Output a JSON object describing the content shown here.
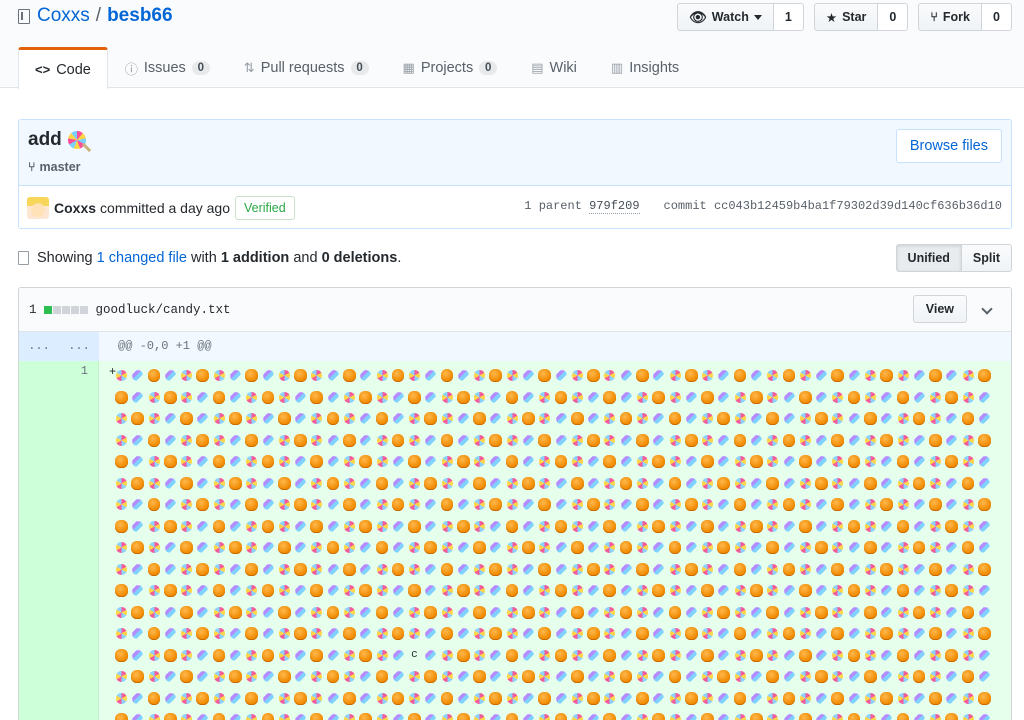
{
  "repo": {
    "owner": "Coxxs",
    "separator": "/",
    "name": "besb66"
  },
  "actions": {
    "watch": {
      "label": "Watch",
      "count": "1"
    },
    "star": {
      "label": "Star",
      "count": "0"
    },
    "fork": {
      "label": "Fork",
      "count": "0"
    }
  },
  "nav": {
    "tabs": [
      {
        "label": "Code",
        "icon": "<>"
      },
      {
        "label": "Issues",
        "count": "0"
      },
      {
        "label": "Pull requests",
        "count": "0"
      },
      {
        "label": "Projects",
        "count": "0"
      },
      {
        "label": "Wiki"
      },
      {
        "label": "Insights"
      }
    ]
  },
  "commit": {
    "title": "add",
    "branch": "master",
    "browse_label": "Browse files",
    "author": "Coxxs",
    "committed_text": "committed a day ago",
    "verified": "Verified",
    "parent_label": "1 parent",
    "parent_sha": "979f209",
    "commit_label": "commit",
    "commit_sha": "cc043b12459b4ba1f79302d39d140cf636b36d10"
  },
  "toc": {
    "showing": "Showing",
    "changed_link": "1 changed file",
    "with": "with",
    "additions": "1 addition",
    "and": "and",
    "deletions": "0 deletions",
    "period": ".",
    "unified": "Unified",
    "split": "Split"
  },
  "file": {
    "stat_count": "1",
    "path": "goodluck/candy.txt",
    "view_label": "View",
    "hunk_old": "...",
    "hunk_new": "...",
    "hunk_header": "@@ -0,0 +1 @@",
    "line_number": "1",
    "plus": "+",
    "inline_char": "c"
  }
}
